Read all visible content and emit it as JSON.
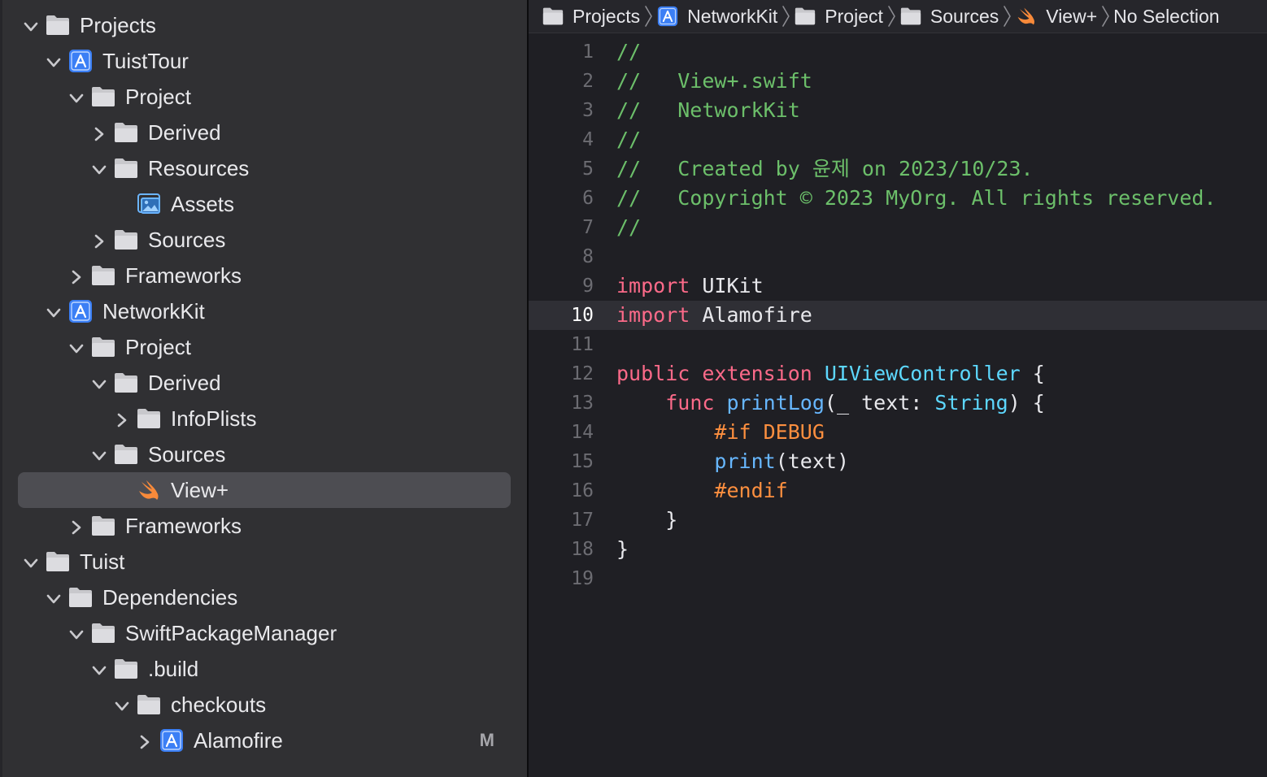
{
  "navigator": {
    "rows": [
      {
        "label": "Projects",
        "depth": 0,
        "icon": "folder-icon",
        "chevron": "down"
      },
      {
        "label": "TuistTour",
        "depth": 1,
        "icon": "xcode-project-icon",
        "chevron": "down"
      },
      {
        "label": "Project",
        "depth": 2,
        "icon": "folder-icon",
        "chevron": "down"
      },
      {
        "label": "Derived",
        "depth": 3,
        "icon": "folder-icon",
        "chevron": "right"
      },
      {
        "label": "Resources",
        "depth": 3,
        "icon": "folder-icon",
        "chevron": "down"
      },
      {
        "label": "Assets",
        "depth": 4,
        "icon": "asset-catalog-icon",
        "chevron": "none"
      },
      {
        "label": "Sources",
        "depth": 3,
        "icon": "folder-icon",
        "chevron": "right"
      },
      {
        "label": "Frameworks",
        "depth": 2,
        "icon": "folder-icon",
        "chevron": "right"
      },
      {
        "label": "NetworkKit",
        "depth": 1,
        "icon": "xcode-project-icon",
        "chevron": "down"
      },
      {
        "label": "Project",
        "depth": 2,
        "icon": "folder-icon",
        "chevron": "down"
      },
      {
        "label": "Derived",
        "depth": 3,
        "icon": "folder-icon",
        "chevron": "down"
      },
      {
        "label": "InfoPlists",
        "depth": 4,
        "icon": "folder-icon",
        "chevron": "right"
      },
      {
        "label": "Sources",
        "depth": 3,
        "icon": "folder-icon",
        "chevron": "down"
      },
      {
        "label": "View+",
        "depth": 4,
        "icon": "swift-icon",
        "chevron": "none",
        "selected": true
      },
      {
        "label": "Frameworks",
        "depth": 2,
        "icon": "folder-icon",
        "chevron": "right"
      },
      {
        "label": "Tuist",
        "depth": 0,
        "icon": "folder-icon",
        "chevron": "down"
      },
      {
        "label": "Dependencies",
        "depth": 1,
        "icon": "folder-icon",
        "chevron": "down"
      },
      {
        "label": "SwiftPackageManager",
        "depth": 2,
        "icon": "folder-icon",
        "chevron": "down"
      },
      {
        "label": ".build",
        "depth": 3,
        "icon": "folder-icon",
        "chevron": "down"
      },
      {
        "label": "checkouts",
        "depth": 4,
        "icon": "folder-icon",
        "chevron": "down"
      },
      {
        "label": "Alamofire",
        "depth": 5,
        "icon": "xcode-project-icon",
        "chevron": "right",
        "status": "M"
      }
    ]
  },
  "jumpbar": {
    "crumbs": [
      {
        "label": "Projects",
        "icon": "folder-icon"
      },
      {
        "label": "NetworkKit",
        "icon": "xcode-project-icon"
      },
      {
        "label": "Project",
        "icon": "folder-icon"
      },
      {
        "label": "Sources",
        "icon": "folder-icon"
      },
      {
        "label": "View+",
        "icon": "swift-icon"
      },
      {
        "label": "No Selection",
        "icon": ""
      }
    ]
  },
  "editor": {
    "current_line": 10,
    "lines": [
      {
        "n": "1",
        "tokens": [
          {
            "t": "//",
            "c": "comment"
          }
        ]
      },
      {
        "n": "2",
        "tokens": [
          {
            "t": "//   View+.swift",
            "c": "comment"
          }
        ]
      },
      {
        "n": "3",
        "tokens": [
          {
            "t": "//   NetworkKit",
            "c": "comment"
          }
        ]
      },
      {
        "n": "4",
        "tokens": [
          {
            "t": "//",
            "c": "comment"
          }
        ]
      },
      {
        "n": "5",
        "tokens": [
          {
            "t": "//   Created by 윤제 on 2023/10/23.",
            "c": "comment"
          }
        ]
      },
      {
        "n": "6",
        "tokens": [
          {
            "t": "//   Copyright © 2023 MyOrg. All rights reserved.",
            "c": "comment"
          }
        ]
      },
      {
        "n": "7",
        "tokens": [
          {
            "t": "//",
            "c": "comment"
          }
        ]
      },
      {
        "n": "8",
        "tokens": []
      },
      {
        "n": "9",
        "tokens": [
          {
            "t": "import",
            "c": "kw"
          },
          {
            "t": " UIKit",
            "c": "plain"
          }
        ]
      },
      {
        "n": "10",
        "tokens": [
          {
            "t": "import",
            "c": "kw"
          },
          {
            "t": " Alamofire",
            "c": "plain"
          }
        ]
      },
      {
        "n": "11",
        "tokens": []
      },
      {
        "n": "12",
        "tokens": [
          {
            "t": "public",
            "c": "kw"
          },
          {
            "t": " ",
            "c": "plain"
          },
          {
            "t": "extension",
            "c": "kw"
          },
          {
            "t": " ",
            "c": "plain"
          },
          {
            "t": "UIViewController",
            "c": "type"
          },
          {
            "t": " {",
            "c": "plain"
          }
        ]
      },
      {
        "n": "13",
        "tokens": [
          {
            "t": "    ",
            "c": "plain"
          },
          {
            "t": "func",
            "c": "kw"
          },
          {
            "t": " ",
            "c": "plain"
          },
          {
            "t": "printLog",
            "c": "call"
          },
          {
            "t": "(_ text: ",
            "c": "plain"
          },
          {
            "t": "String",
            "c": "type"
          },
          {
            "t": ") {",
            "c": "plain"
          }
        ]
      },
      {
        "n": "14",
        "tokens": [
          {
            "t": "        ",
            "c": "plain"
          },
          {
            "t": "#if DEBUG",
            "c": "pre"
          }
        ]
      },
      {
        "n": "15",
        "tokens": [
          {
            "t": "        ",
            "c": "plain"
          },
          {
            "t": "print",
            "c": "call"
          },
          {
            "t": "(text)",
            "c": "plain"
          }
        ]
      },
      {
        "n": "16",
        "tokens": [
          {
            "t": "        ",
            "c": "plain"
          },
          {
            "t": "#endif",
            "c": "pre"
          }
        ]
      },
      {
        "n": "17",
        "tokens": [
          {
            "t": "    }",
            "c": "plain"
          }
        ]
      },
      {
        "n": "18",
        "tokens": [
          {
            "t": "}",
            "c": "plain"
          }
        ]
      },
      {
        "n": "19",
        "tokens": []
      }
    ]
  },
  "colors": {
    "comment": "#6cbf6a",
    "keyword": "#fc6a89",
    "type": "#5dd8ff",
    "call": "#67b7ff",
    "preprocessor": "#fd8f3f",
    "selection": "#4d4d52",
    "project_icon": "#3b7ff5",
    "swift_icon": "#f88a3a"
  }
}
